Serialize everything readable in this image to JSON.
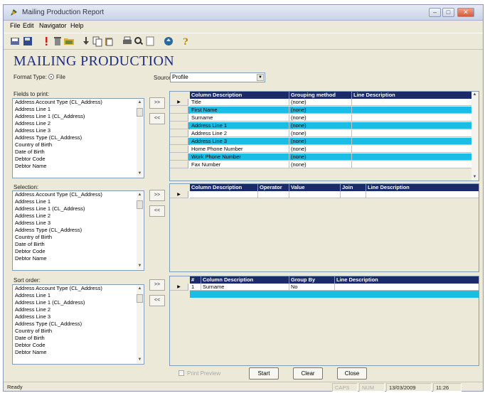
{
  "window": {
    "title": "Mailing Production Report",
    "controls": {
      "minimize": "–",
      "maximize": "□",
      "close": "✕"
    }
  },
  "menu": [
    "File",
    "Edit",
    "Navigator",
    "Help"
  ],
  "toolbar": {
    "icons": [
      "save-icon",
      "disk-icon",
      "exclamation-icon",
      "delete-icon",
      "folder-icon",
      "import-icon",
      "copy-icon",
      "paste-icon",
      "print-icon",
      "preview-icon",
      "page-icon",
      "report-icon",
      "help-icon"
    ]
  },
  "header": {
    "title": "MAILING PRODUCTION",
    "format_type_label": "Format Type:",
    "format_type_value": "File",
    "source_label": "Source:",
    "source_value": "Profile"
  },
  "fields_to_print": {
    "label": "Fields to print:",
    "items": [
      "Address Account Type (CL_Address)",
      "Address Line 1",
      "Address Line 1 (CL_Address)",
      "Address Line 2",
      "Address Line 3",
      "Address Type (CL_Address)",
      "Country of Birth",
      "Date of Birth",
      "Debtor Code",
      "Debtor Name"
    ]
  },
  "selection": {
    "label": "Selection:",
    "items": [
      "Address Account Type (CL_Address)",
      "Address Line 1",
      "Address Line 1 (CL_Address)",
      "Address Line 2",
      "Address Line 3",
      "Address Type (CL_Address)",
      "Country of Birth",
      "Date of Birth",
      "Debtor Code",
      "Debtor Name"
    ]
  },
  "sort_order": {
    "label": "Sort order:",
    "items": [
      "Address Account Type (CL_Address)",
      "Address Line 1",
      "Address Line 1 (CL_Address)",
      "Address Line 2",
      "Address Line 3",
      "Address Type (CL_Address)",
      "Country of Birth",
      "Date of Birth",
      "Debtor Code",
      "Debtor Name"
    ]
  },
  "move_buttons": {
    "add": ">>",
    "remove": "<<"
  },
  "print_grid": {
    "columns": [
      "Column Description",
      "Grouping method",
      "Line Description"
    ],
    "rows": [
      {
        "col": "Title",
        "group": "(none)",
        "line": "",
        "highlight": false
      },
      {
        "col": "First Name",
        "group": "(none)",
        "line": "",
        "highlight": true
      },
      {
        "col": "Surname",
        "group": "(none)",
        "line": "",
        "highlight": false
      },
      {
        "col": "Address Line 1",
        "group": "(none)",
        "line": "",
        "highlight": true
      },
      {
        "col": "Address Line 2",
        "group": "(none)",
        "line": "",
        "highlight": false
      },
      {
        "col": "Address Line 3",
        "group": "(none)",
        "line": "",
        "highlight": true
      },
      {
        "col": "Home Phone Number",
        "group": "(none)",
        "line": "",
        "highlight": false
      },
      {
        "col": "Work Phone Number",
        "group": "(none)",
        "line": "",
        "highlight": true
      },
      {
        "col": "Fax Number",
        "group": "(none)",
        "line": "",
        "highlight": false
      }
    ]
  },
  "selection_grid": {
    "columns": [
      "Column Description",
      "Operator",
      "Value",
      "Join",
      "Line Description"
    ]
  },
  "sort_grid": {
    "columns": [
      "#",
      "Column Description",
      "Group By",
      "Line Description"
    ],
    "rows": [
      {
        "num": "1",
        "col": "Surname",
        "group": "No",
        "line": ""
      }
    ]
  },
  "actions": {
    "print_preview": "Print Preview",
    "start": "Start",
    "clear": "Clear",
    "close": "Close"
  },
  "status": {
    "ready": "Ready",
    "caps": "CAPS",
    "num": "NUM",
    "date": "13/03/2009",
    "time": "11:26"
  },
  "colors": {
    "header": "#1a2a6b",
    "highlight": "#19bde6",
    "title": "#1e2f8a"
  }
}
